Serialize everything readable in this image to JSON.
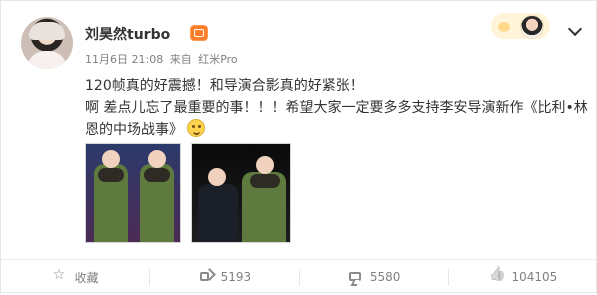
{
  "post": {
    "author": "刘昊然turbo",
    "time": "11月6日 21:08",
    "via_label": "来自",
    "source": "红米Pro",
    "lines": [
      "120帧真的好震撼！和导演合影真的好紧张！",
      "啊 差点儿忘了最重要的事！！！希望大家一定要多多支持李安导演新作《比利•林",
      "恩的中场战事》"
    ]
  },
  "icons": {
    "avatar": "user-avatar",
    "vip": "vip-badge-icon",
    "more": "chevron-down-icon",
    "collect": "star-icon",
    "forward": "forward-icon",
    "comment": "comment-icon",
    "like": "like-icon",
    "emoji": "smile-emoji-icon"
  },
  "actions": [
    {
      "label": "收藏"
    },
    {
      "label": "5193"
    },
    {
      "label": "5580"
    },
    {
      "label": "104105"
    }
  ],
  "colors": {
    "text": "#333333",
    "meta": "#808080",
    "pill_bg": "#fff3d8"
  }
}
